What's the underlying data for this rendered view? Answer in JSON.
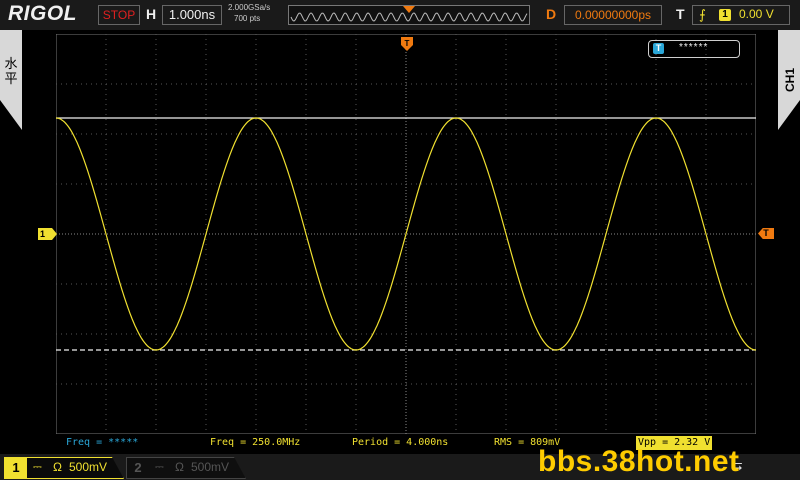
{
  "topbar": {
    "brand": "RIGOL",
    "run_state": "STOP",
    "timebase_label": "H",
    "timebase_value": "1.000ns",
    "sample_rate": "2.000GSa/s",
    "memory_depth": "700  pts",
    "delay_label": "D",
    "delay_value": "0.00000000ps",
    "trigger_label": "T",
    "trigger_source": "1",
    "trigger_level": "0.00 V",
    "trigger_slope_icon": "rising-edge-icon"
  },
  "left_tab": {
    "label_line1": "水",
    "label_line2": "平"
  },
  "right_tab": {
    "label": "CH1"
  },
  "notice": {
    "text": "******"
  },
  "markers": {
    "ch1": "1",
    "trig_level": "T",
    "trig_pos": "T"
  },
  "measurements": {
    "freq_ch2": "Freq = *****",
    "freq_ch1": "Freq = 250.0MHz",
    "period": "Period = 4.000ns",
    "rms": "RMS = 809mV",
    "vpp": "Vpp = 2.32 V"
  },
  "channels": [
    {
      "num": "1",
      "coupling": "⎓",
      "impedance": "Ω",
      "scale": "500mV",
      "active": true
    },
    {
      "num": "2",
      "coupling": "⎓",
      "impedance": "Ω",
      "scale": "500mV",
      "active": false
    }
  ],
  "watermark": "bbs.38hot.net",
  "colors": {
    "ch1": "#f0e030",
    "ch2": "#2aa7d8",
    "trigger": "#f07a10",
    "stop": "#e02020"
  },
  "chart_data": {
    "type": "line",
    "title": "",
    "xlabel": "",
    "ylabel": "",
    "x_unit": "ns",
    "y_unit": "V",
    "x_div": 1.0,
    "y_div": 0.5,
    "xlim": [
      -7.0,
      7.0
    ],
    "ylim": [
      -2.0,
      2.0
    ],
    "grid": true,
    "series": [
      {
        "name": "CH1",
        "frequency_mhz": 250.0,
        "period_ns": 4.0,
        "amplitude_vpp": 2.32,
        "offset_v": 0.0,
        "phase_peak_at_ns": -7.0
      }
    ],
    "cursor_lines_v": [
      1.16,
      -1.16
    ]
  }
}
